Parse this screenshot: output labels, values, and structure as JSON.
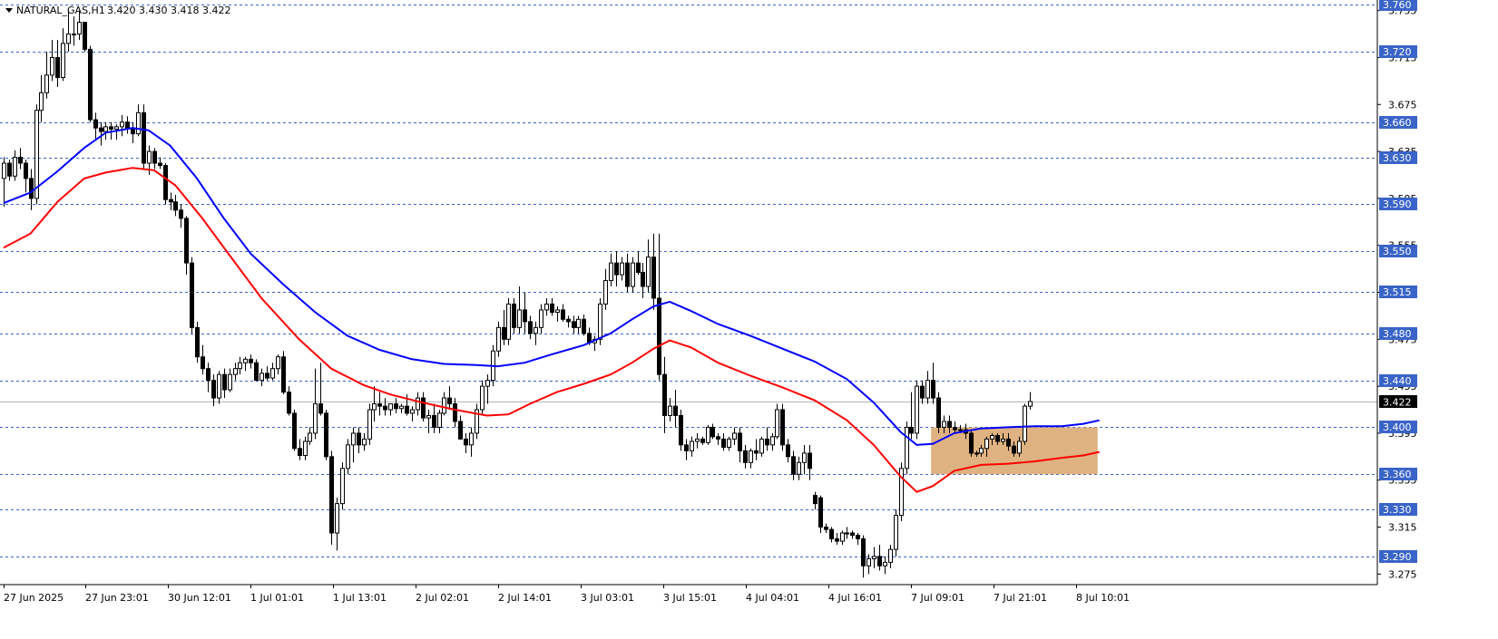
{
  "header": {
    "symbol": "NATURAL_GAS,H1",
    "ohlc": "3.420 3.430 3.418 3.422"
  },
  "colors": {
    "bull": "#ffffff",
    "bear": "#000000",
    "wick": "#000000",
    "ma_fast": "#0000ff",
    "ma_slow": "#ff0000",
    "level_line": "#3a64c8",
    "level_label_bg": "#3a64c8",
    "zone": "#d9a66b",
    "current_price_bg": "#000000"
  },
  "chart_data": {
    "type": "candlestick",
    "ylim": [
      3.266,
      3.764
    ],
    "y_ticks": [
      3.275,
      3.315,
      3.355,
      3.395,
      3.435,
      3.475,
      3.515,
      3.555,
      3.595,
      3.635,
      3.675,
      3.715,
      3.755
    ],
    "x_labels": [
      "27 Jun 2025",
      "27 Jun 23:01",
      "30 Jun 12:01",
      "1 Jul 01:01",
      "1 Jul 13:01",
      "2 Jul 02:01",
      "2 Jul 14:01",
      "3 Jul 03:01",
      "3 Jul 15:01",
      "4 Jul 04:01",
      "4 Jul 16:01",
      "7 Jul 09:01",
      "7 Jul 21:01",
      "8 Jul 10:01"
    ],
    "levels": [
      "3.760",
      "3.720",
      "3.660",
      "3.630",
      "3.590",
      "3.550",
      "3.515",
      "3.480",
      "3.440",
      "3.400",
      "3.360",
      "3.330",
      "3.290"
    ],
    "current_price": "3.422",
    "zone": {
      "from_candle": 173,
      "to_candle": 203,
      "high": 3.4,
      "low": 3.36
    },
    "candles": [
      [
        3.612,
        3.63,
        3.588,
        3.625
      ],
      [
        3.625,
        3.628,
        3.61,
        3.614
      ],
      [
        3.614,
        3.636,
        3.61,
        3.63
      ],
      [
        3.63,
        3.638,
        3.62,
        3.625
      ],
      [
        3.625,
        3.628,
        3.6,
        3.612
      ],
      [
        3.612,
        3.62,
        3.585,
        3.595
      ],
      [
        3.595,
        3.675,
        3.59,
        3.67
      ],
      [
        3.67,
        3.7,
        3.66,
        3.685
      ],
      [
        3.685,
        3.72,
        3.68,
        3.7
      ],
      [
        3.7,
        3.73,
        3.695,
        3.715
      ],
      [
        3.715,
        3.73,
        3.69,
        3.698
      ],
      [
        3.698,
        3.74,
        3.695,
        3.727
      ],
      [
        3.727,
        3.755,
        3.72,
        3.735
      ],
      [
        3.735,
        3.75,
        3.725,
        3.735
      ],
      [
        3.735,
        3.755,
        3.73,
        3.745
      ],
      [
        3.745,
        3.745,
        3.72,
        3.722
      ],
      [
        3.722,
        3.725,
        3.66,
        3.662
      ],
      [
        3.662,
        3.668,
        3.645,
        3.655
      ],
      [
        3.655,
        3.66,
        3.64,
        3.652
      ],
      [
        3.652,
        3.66,
        3.645,
        3.656
      ],
      [
        3.656,
        3.66,
        3.645,
        3.654
      ],
      [
        3.654,
        3.658,
        3.645,
        3.656
      ],
      [
        3.656,
        3.666,
        3.648,
        3.66
      ],
      [
        3.66,
        3.665,
        3.65,
        3.655
      ],
      [
        3.655,
        3.66,
        3.642,
        3.65
      ],
      [
        3.65,
        3.675,
        3.648,
        3.668
      ],
      [
        3.668,
        3.675,
        3.62,
        3.625
      ],
      [
        3.625,
        3.64,
        3.615,
        3.635
      ],
      [
        3.635,
        3.638,
        3.62,
        3.625
      ],
      [
        3.625,
        3.63,
        3.62,
        3.623
      ],
      [
        3.623,
        3.625,
        3.59,
        3.594
      ],
      [
        3.594,
        3.6,
        3.585,
        3.592
      ],
      [
        3.592,
        3.598,
        3.58,
        3.585
      ],
      [
        3.585,
        3.59,
        3.57,
        3.578
      ],
      [
        3.578,
        3.58,
        3.53,
        3.54
      ],
      [
        3.54,
        3.545,
        3.48,
        3.485
      ],
      [
        3.485,
        3.49,
        3.455,
        3.46
      ],
      [
        3.46,
        3.47,
        3.445,
        3.45
      ],
      [
        3.45,
        3.455,
        3.43,
        3.44
      ],
      [
        3.44,
        3.445,
        3.418,
        3.425
      ],
      [
        3.425,
        3.448,
        3.42,
        3.445
      ],
      [
        3.445,
        3.45,
        3.425,
        3.432
      ],
      [
        3.432,
        3.45,
        3.43,
        3.445
      ],
      [
        3.445,
        3.455,
        3.44,
        3.45
      ],
      [
        3.45,
        3.46,
        3.445,
        3.455
      ],
      [
        3.455,
        3.46,
        3.448,
        3.458
      ],
      [
        3.458,
        3.462,
        3.45,
        3.455
      ],
      [
        3.455,
        3.458,
        3.44,
        3.44
      ],
      [
        3.44,
        3.45,
        3.435,
        3.446
      ],
      [
        3.446,
        3.452,
        3.44,
        3.442
      ],
      [
        3.442,
        3.455,
        3.44,
        3.45
      ],
      [
        3.45,
        3.462,
        3.445,
        3.46
      ],
      [
        3.46,
        3.465,
        3.428,
        3.43
      ],
      [
        3.43,
        3.435,
        3.41,
        3.412
      ],
      [
        3.412,
        3.415,
        3.38,
        3.382
      ],
      [
        3.382,
        3.39,
        3.372,
        3.376
      ],
      [
        3.376,
        3.392,
        3.372,
        3.388
      ],
      [
        3.388,
        3.4,
        3.385,
        3.395
      ],
      [
        3.395,
        3.45,
        3.39,
        3.42
      ],
      [
        3.42,
        3.455,
        3.41,
        3.412
      ],
      [
        3.412,
        3.415,
        3.372,
        3.375
      ],
      [
        3.375,
        3.38,
        3.3,
        3.31
      ],
      [
        3.31,
        3.34,
        3.295,
        3.335
      ],
      [
        3.335,
        3.37,
        3.33,
        3.365
      ],
      [
        3.365,
        3.39,
        3.36,
        3.385
      ],
      [
        3.385,
        3.4,
        3.37,
        3.395
      ],
      [
        3.395,
        3.4,
        3.378,
        3.385
      ],
      [
        3.385,
        3.395,
        3.38,
        3.39
      ],
      [
        3.39,
        3.42,
        3.385,
        3.415
      ],
      [
        3.415,
        3.435,
        3.405,
        3.42
      ],
      [
        3.42,
        3.43,
        3.41,
        3.418
      ],
      [
        3.418,
        3.425,
        3.41,
        3.415
      ],
      [
        3.415,
        3.42,
        3.41,
        3.42
      ],
      [
        3.42,
        3.425,
        3.412,
        3.416
      ],
      [
        3.416,
        3.42,
        3.412,
        3.418
      ],
      [
        3.418,
        3.428,
        3.41,
        3.412
      ],
      [
        3.412,
        3.418,
        3.405,
        3.415
      ],
      [
        3.415,
        3.43,
        3.41,
        3.425
      ],
      [
        3.425,
        3.43,
        3.405,
        3.408
      ],
      [
        3.408,
        3.415,
        3.395,
        3.41
      ],
      [
        3.41,
        3.42,
        3.395,
        3.4
      ],
      [
        3.4,
        3.415,
        3.395,
        3.412
      ],
      [
        3.412,
        3.43,
        3.41,
        3.425
      ],
      [
        3.425,
        3.435,
        3.415,
        3.42
      ],
      [
        3.42,
        3.425,
        3.4,
        3.405
      ],
      [
        3.405,
        3.41,
        3.39,
        3.39
      ],
      [
        3.39,
        3.395,
        3.378,
        3.385
      ],
      [
        3.385,
        3.4,
        3.375,
        3.395
      ],
      [
        3.395,
        3.42,
        3.39,
        3.415
      ],
      [
        3.415,
        3.44,
        3.41,
        3.435
      ],
      [
        3.435,
        3.445,
        3.42,
        3.44
      ],
      [
        3.44,
        3.47,
        3.435,
        3.465
      ],
      [
        3.465,
        3.49,
        3.46,
        3.485
      ],
      [
        3.485,
        3.5,
        3.47,
        3.475
      ],
      [
        3.475,
        3.51,
        3.47,
        3.505
      ],
      [
        3.505,
        3.51,
        3.48,
        3.485
      ],
      [
        3.485,
        3.52,
        3.48,
        3.5
      ],
      [
        3.5,
        3.515,
        3.48,
        3.49
      ],
      [
        3.49,
        3.495,
        3.475,
        3.48
      ],
      [
        3.48,
        3.49,
        3.47,
        3.485
      ],
      [
        3.485,
        3.505,
        3.48,
        3.5
      ],
      [
        3.5,
        3.51,
        3.495,
        3.505
      ],
      [
        3.505,
        3.51,
        3.495,
        3.498
      ],
      [
        3.498,
        3.503,
        3.49,
        3.5
      ],
      [
        3.5,
        3.505,
        3.49,
        3.492
      ],
      [
        3.492,
        3.495,
        3.485,
        3.49
      ],
      [
        3.49,
        3.495,
        3.48,
        3.485
      ],
      [
        3.485,
        3.495,
        3.48,
        3.492
      ],
      [
        3.492,
        3.496,
        3.478,
        3.48
      ],
      [
        3.48,
        3.485,
        3.47,
        3.472
      ],
      [
        3.472,
        3.478,
        3.465,
        3.475
      ],
      [
        3.475,
        3.51,
        3.47,
        3.505
      ],
      [
        3.505,
        3.535,
        3.5,
        3.525
      ],
      [
        3.525,
        3.548,
        3.52,
        3.54
      ],
      [
        3.54,
        3.55,
        3.52,
        3.53
      ],
      [
        3.53,
        3.545,
        3.525,
        3.54
      ],
      [
        3.54,
        3.548,
        3.515,
        3.52
      ],
      [
        3.52,
        3.545,
        3.515,
        3.54
      ],
      [
        3.54,
        3.55,
        3.53,
        3.532
      ],
      [
        3.532,
        3.54,
        3.51,
        3.52
      ],
      [
        3.52,
        3.56,
        3.515,
        3.545
      ],
      [
        3.545,
        3.565,
        3.5,
        3.51
      ],
      [
        3.51,
        3.565,
        3.44,
        3.445
      ],
      [
        3.445,
        3.46,
        3.395,
        3.41
      ],
      [
        3.41,
        3.425,
        3.405,
        3.418
      ],
      [
        3.418,
        3.432,
        3.4,
        3.41
      ],
      [
        3.41,
        3.415,
        3.38,
        3.385
      ],
      [
        3.385,
        3.39,
        3.372,
        3.38
      ],
      [
        3.38,
        3.392,
        3.375,
        3.388
      ],
      [
        3.388,
        3.395,
        3.382,
        3.39
      ],
      [
        3.39,
        3.392,
        3.385,
        3.387
      ],
      [
        3.387,
        3.402,
        3.385,
        3.4
      ],
      [
        3.4,
        3.403,
        3.39,
        3.392
      ],
      [
        3.392,
        3.395,
        3.385,
        3.39
      ],
      [
        3.39,
        3.395,
        3.38,
        3.383
      ],
      [
        3.383,
        3.392,
        3.38,
        3.39
      ],
      [
        3.39,
        3.4,
        3.385,
        3.395
      ],
      [
        3.395,
        3.4,
        3.37,
        3.38
      ],
      [
        3.38,
        3.385,
        3.365,
        3.37
      ],
      [
        3.37,
        3.382,
        3.365,
        3.38
      ],
      [
        3.38,
        3.39,
        3.372,
        3.378
      ],
      [
        3.378,
        3.392,
        3.375,
        3.39
      ],
      [
        3.39,
        3.4,
        3.38,
        3.385
      ],
      [
        3.385,
        3.395,
        3.38,
        3.392
      ],
      [
        3.392,
        3.42,
        3.39,
        3.415
      ],
      [
        3.415,
        3.42,
        3.38,
        3.385
      ],
      [
        3.385,
        3.39,
        3.37,
        3.375
      ],
      [
        3.375,
        3.38,
        3.355,
        3.36
      ],
      [
        3.36,
        3.375,
        3.355,
        3.37
      ],
      [
        3.37,
        3.385,
        3.36,
        3.378
      ],
      [
        3.378,
        3.385,
        3.355,
        3.365
      ],
      [
        3.342,
        3.345,
        3.33,
        3.335
      ],
      [
        3.34,
        3.342,
        3.31,
        3.315
      ],
      [
        3.315,
        3.318,
        3.31,
        3.313
      ],
      [
        3.313,
        3.315,
        3.302,
        3.305
      ],
      [
        3.305,
        3.31,
        3.3,
        3.303
      ],
      [
        3.303,
        3.312,
        3.3,
        3.31
      ],
      [
        3.31,
        3.315,
        3.305,
        3.31
      ],
      [
        3.31,
        3.312,
        3.305,
        3.308
      ],
      [
        3.308,
        3.31,
        3.3,
        3.305
      ],
      [
        3.305,
        3.308,
        3.272,
        3.282
      ],
      [
        3.282,
        3.292,
        3.275,
        3.288
      ],
      [
        3.288,
        3.298,
        3.28,
        3.29
      ],
      [
        3.29,
        3.3,
        3.278,
        3.282
      ],
      [
        3.282,
        3.29,
        3.275,
        3.285
      ],
      [
        3.285,
        3.3,
        3.28,
        3.296
      ],
      [
        3.296,
        3.33,
        3.29,
        3.325
      ],
      [
        3.325,
        3.37,
        3.32,
        3.365
      ],
      [
        3.365,
        3.405,
        3.36,
        3.4
      ],
      [
        3.4,
        3.43,
        3.39,
        3.395
      ],
      [
        3.395,
        3.44,
        3.39,
        3.435
      ],
      [
        3.435,
        3.44,
        3.42,
        3.425
      ],
      [
        3.425,
        3.448,
        3.42,
        3.44
      ],
      [
        3.44,
        3.455,
        3.42,
        3.425
      ],
      [
        3.425,
        3.43,
        3.395,
        3.4
      ],
      [
        3.4,
        3.41,
        3.395,
        3.405
      ],
      [
        3.405,
        3.41,
        3.395,
        3.4
      ],
      [
        3.4,
        3.405,
        3.395,
        3.398
      ],
      [
        3.398,
        3.402,
        3.395,
        3.398
      ],
      [
        3.398,
        3.403,
        3.39,
        3.395
      ],
      [
        3.395,
        3.398,
        3.375,
        3.378
      ],
      [
        3.378,
        3.38,
        3.375,
        3.378
      ],
      [
        3.378,
        3.385,
        3.375,
        3.382
      ],
      [
        3.382,
        3.392,
        3.375,
        3.39
      ],
      [
        3.39,
        3.395,
        3.385,
        3.393
      ],
      [
        3.393,
        3.395,
        3.385,
        3.388
      ],
      [
        3.388,
        3.395,
        3.385,
        3.39
      ],
      [
        3.39,
        3.395,
        3.38,
        3.384
      ],
      [
        3.384,
        3.388,
        3.375,
        3.378
      ],
      [
        3.378,
        3.392,
        3.375,
        3.388
      ],
      [
        3.388,
        3.42,
        3.385,
        3.418
      ],
      [
        3.418,
        3.43,
        3.415,
        3.422
      ]
    ],
    "ma_fast": [
      [
        0,
        3.591
      ],
      [
        5,
        3.6
      ],
      [
        10,
        3.618
      ],
      [
        15,
        3.638
      ],
      [
        19,
        3.651
      ],
      [
        24,
        3.655
      ],
      [
        27,
        3.653
      ],
      [
        31,
        3.64
      ],
      [
        36,
        3.612
      ],
      [
        41,
        3.578
      ],
      [
        46,
        3.548
      ],
      [
        52,
        3.522
      ],
      [
        58,
        3.498
      ],
      [
        64,
        3.478
      ],
      [
        70,
        3.466
      ],
      [
        76,
        3.458
      ],
      [
        82,
        3.454
      ],
      [
        88,
        3.453
      ],
      [
        92,
        3.452
      ],
      [
        97,
        3.455
      ],
      [
        102,
        3.462
      ],
      [
        108,
        3.47
      ],
      [
        113,
        3.48
      ],
      [
        117,
        3.492
      ],
      [
        121,
        3.503
      ],
      [
        124,
        3.507
      ],
      [
        128,
        3.499
      ],
      [
        133,
        3.488
      ],
      [
        139,
        3.478
      ],
      [
        145,
        3.467
      ],
      [
        151,
        3.456
      ],
      [
        157,
        3.441
      ],
      [
        162,
        3.421
      ],
      [
        167,
        3.396
      ],
      [
        170,
        3.385
      ],
      [
        173,
        3.386
      ],
      [
        177,
        3.395
      ],
      [
        182,
        3.399
      ],
      [
        187,
        3.4
      ],
      [
        192,
        3.401
      ],
      [
        197,
        3.401
      ],
      [
        201,
        3.403
      ],
      [
        204,
        3.406
      ]
    ],
    "ma_slow": [
      [
        0,
        3.553
      ],
      [
        5,
        3.565
      ],
      [
        10,
        3.592
      ],
      [
        15,
        3.612
      ],
      [
        19,
        3.617
      ],
      [
        24,
        3.621
      ],
      [
        28,
        3.619
      ],
      [
        32,
        3.606
      ],
      [
        37,
        3.578
      ],
      [
        42,
        3.547
      ],
      [
        48,
        3.51
      ],
      [
        55,
        3.475
      ],
      [
        61,
        3.45
      ],
      [
        67,
        3.436
      ],
      [
        72,
        3.428
      ],
      [
        78,
        3.421
      ],
      [
        84,
        3.415
      ],
      [
        90,
        3.41
      ],
      [
        94,
        3.411
      ],
      [
        98,
        3.42
      ],
      [
        103,
        3.43
      ],
      [
        108,
        3.437
      ],
      [
        113,
        3.445
      ],
      [
        117,
        3.455
      ],
      [
        121,
        3.467
      ],
      [
        124,
        3.474
      ],
      [
        128,
        3.468
      ],
      [
        133,
        3.455
      ],
      [
        139,
        3.444
      ],
      [
        145,
        3.434
      ],
      [
        151,
        3.423
      ],
      [
        157,
        3.406
      ],
      [
        162,
        3.385
      ],
      [
        167,
        3.358
      ],
      [
        170,
        3.345
      ],
      [
        173,
        3.35
      ],
      [
        177,
        3.363
      ],
      [
        182,
        3.368
      ],
      [
        187,
        3.369
      ],
      [
        192,
        3.371
      ],
      [
        197,
        3.374
      ],
      [
        201,
        3.376
      ],
      [
        204,
        3.379
      ]
    ]
  }
}
